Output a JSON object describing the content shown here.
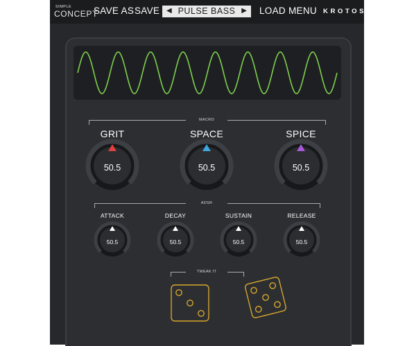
{
  "topbar": {
    "logo_top": "SIMPLE",
    "logo_bottom": "CONCEPT",
    "save_as": "SAVE AS",
    "save": "SAVE",
    "prev_arrow": "◀",
    "preset_name": "PULSE BASS",
    "next_arrow": "▶",
    "load": "LOAD",
    "menu": "MENU",
    "brand": "KROTOS"
  },
  "waveform": {
    "color": "#7fd14e",
    "cycles": 8
  },
  "macro": {
    "label": "MACRO",
    "knobs": [
      {
        "label": "GRIT",
        "value": "50.5",
        "accent": "#e0403e"
      },
      {
        "label": "SPACE",
        "value": "50.5",
        "accent": "#3ea7df"
      },
      {
        "label": "SPICE",
        "value": "50.5",
        "accent": "#a858d8"
      }
    ]
  },
  "adsr": {
    "label": "ADSR",
    "knobs": [
      {
        "label": "ATTACK",
        "value": "50.5"
      },
      {
        "label": "DECAY",
        "value": "50.5"
      },
      {
        "label": "SUSTAIN",
        "value": "50.5"
      },
      {
        "label": "RELEASE",
        "value": "50.5"
      }
    ]
  },
  "tweak": {
    "label": "TWEAK IT",
    "dice_color": "#d6a72c"
  }
}
